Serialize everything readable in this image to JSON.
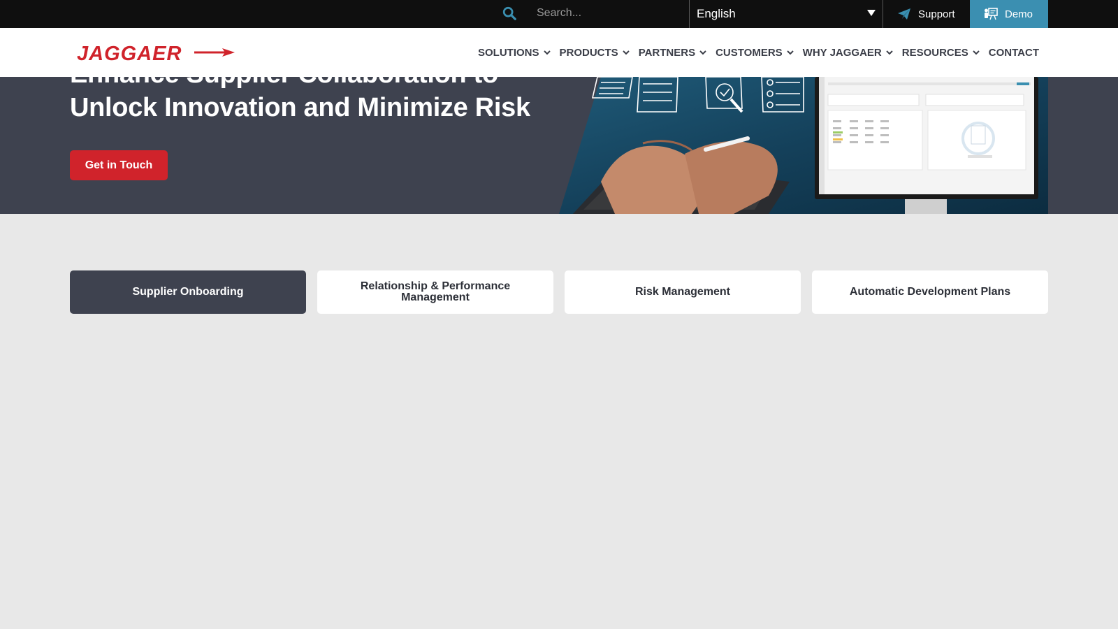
{
  "topbar": {
    "search_placeholder": "Search...",
    "language": "English",
    "support_label": "Support",
    "demo_label": "Demo"
  },
  "navbar": {
    "logo_text": "JAGGAER",
    "items": [
      {
        "label": "SOLUTIONS",
        "has_dropdown": true
      },
      {
        "label": "PRODUCTS",
        "has_dropdown": true
      },
      {
        "label": "PARTNERS",
        "has_dropdown": true
      },
      {
        "label": "CUSTOMERS",
        "has_dropdown": true
      },
      {
        "label": "WHY JAGGAER",
        "has_dropdown": true
      },
      {
        "label": "RESOURCES",
        "has_dropdown": true
      },
      {
        "label": "CONTACT",
        "has_dropdown": false
      }
    ]
  },
  "hero": {
    "title_line1": "Enhance Supplier Collaboration to",
    "title_line2": "Unlock Innovation and Minimize Risk",
    "cta_label": "Get in Touch"
  },
  "tabs": [
    {
      "label": "Supplier Onboarding",
      "active": true
    },
    {
      "label": "Relationship & Performance Management",
      "active": false
    },
    {
      "label": "Risk Management",
      "active": false
    },
    {
      "label": "Automatic Development Plans",
      "active": false
    }
  ],
  "colors": {
    "brand_red": "#d0232b",
    "hero_bg": "#3e424f",
    "demo_blue": "#3b8fb1",
    "accent_teal": "#3a8fb0",
    "page_bg": "#e8e8e8"
  },
  "icons": {
    "search": "search-icon",
    "support": "paper-plane-icon",
    "demo": "presentation-icon",
    "dropdown": "chevron-down-icon",
    "language": "triangle-down-icon"
  }
}
